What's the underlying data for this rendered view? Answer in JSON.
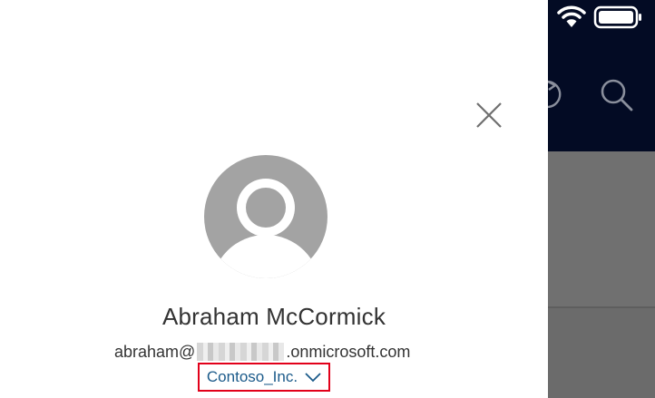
{
  "account": {
    "name": "Abraham McCormick",
    "email_prefix": "abraham@",
    "email_suffix": ".onmicrosoft.com",
    "organization": "Contoso_Inc."
  },
  "icons": {
    "close": "close-icon",
    "avatar": "person-placeholder-icon",
    "org_dropdown": "chevron-down-icon",
    "wifi": "wifi-icon",
    "battery": "battery-icon",
    "search": "search-icon",
    "refresh": "refresh-icon",
    "more": "more-icon"
  },
  "colors": {
    "panel_background": "#ffffff",
    "app_header": "#030b24",
    "app_body": "#707070",
    "avatar": "#a3a3a3",
    "org_text": "#1b5a8a",
    "highlight_border": "#e2001a"
  }
}
